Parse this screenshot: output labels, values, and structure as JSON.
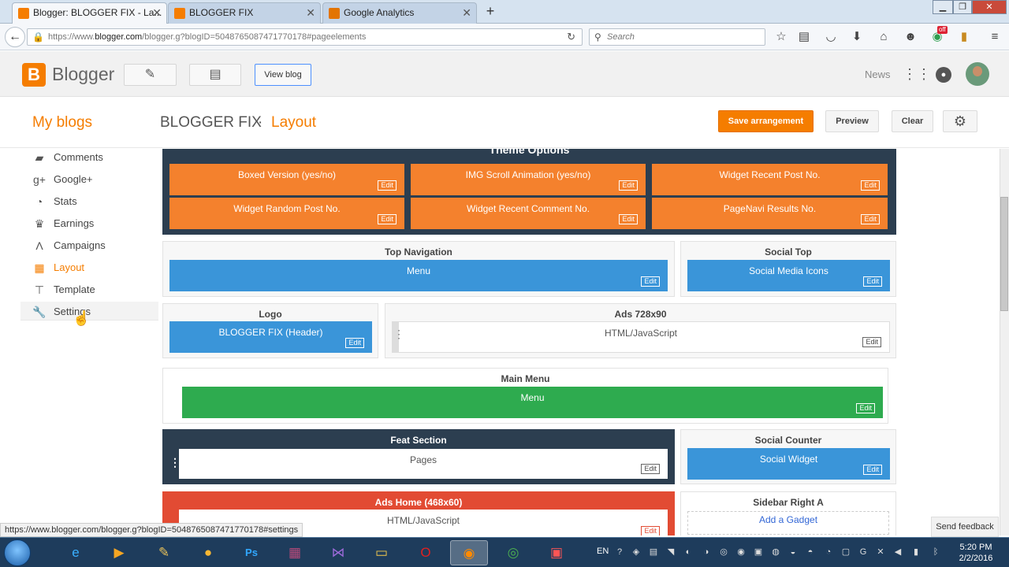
{
  "browser": {
    "tabs": [
      {
        "title": "Blogger: BLOGGER FIX - La...",
        "icon": "blogger-favicon",
        "color": "#f57d00"
      },
      {
        "title": "BLOGGER FIX",
        "icon": "blogger-favicon",
        "color": "#f57d00"
      },
      {
        "title": "Google Analytics",
        "icon": "analytics-favicon",
        "color": "#e37400"
      }
    ],
    "new_tab_label": "+",
    "url_prefix": "https://www.",
    "url_domain": "blogger.com",
    "url_rest": "/blogger.g?blogID=5048765087471770178#pageelements",
    "search_placeholder": "Search",
    "badge_label": "off"
  },
  "blogger_header": {
    "logo_letter": "B",
    "app_name": "Blogger",
    "view_blog_label": "View blog",
    "news_label": "News"
  },
  "subheader": {
    "my_blogs_label": "My blogs",
    "blog_title": "BLOGGER FIX",
    "separator": "·",
    "page_title": "Layout",
    "save_label": "Save arrangement",
    "preview_label": "Preview",
    "clear_label": "Clear"
  },
  "sidebar": {
    "items": [
      {
        "label": "Comments",
        "icon": "comments-icon"
      },
      {
        "label": "Google+",
        "icon": "google-plus-icon"
      },
      {
        "label": "Stats",
        "icon": "stats-icon"
      },
      {
        "label": "Earnings",
        "icon": "earnings-icon"
      },
      {
        "label": "Campaigns",
        "icon": "campaigns-icon"
      },
      {
        "label": "Layout",
        "icon": "layout-icon",
        "active": true
      },
      {
        "label": "Template",
        "icon": "template-icon"
      },
      {
        "label": "Settings",
        "icon": "settings-icon"
      }
    ]
  },
  "layout": {
    "edit_label": "Edit",
    "theme_options": {
      "title": "Theme Options",
      "widgets": [
        "Boxed Version (yes/no)",
        "IMG Scroll Animation (yes/no)",
        "Widget Recent Post No.",
        "Widget Random Post No.",
        "Widget Recent Comment No.",
        "PageNavi Results No."
      ]
    },
    "top_navigation": {
      "title": "Top Navigation",
      "widget": "Menu"
    },
    "social_top": {
      "title": "Social Top",
      "widget": "Social Media Icons"
    },
    "logo": {
      "title": "Logo",
      "widget": "BLOGGER FIX (Header)"
    },
    "ads_728": {
      "title": "Ads 728x90",
      "widget": "HTML/JavaScript"
    },
    "main_menu": {
      "title": "Main Menu",
      "widget": "Menu"
    },
    "feat_section": {
      "title": "Feat Section",
      "widget": "Pages"
    },
    "social_counter": {
      "title": "Social Counter",
      "widget": "Social Widget"
    },
    "ads_home": {
      "title": "Ads Home (468x60)",
      "widget": "HTML/JavaScript"
    },
    "sidebar_right_a": {
      "title": "Sidebar Right A",
      "add_gadget": "Add a Gadget"
    }
  },
  "status": {
    "hover_url": "https://www.blogger.com/blogger.g?blogID=5048765087471770178#settings",
    "feedback_label": "Send feedback"
  },
  "taskbar": {
    "language": "EN",
    "time": "5:20 PM",
    "date": "2/2/2016"
  }
}
